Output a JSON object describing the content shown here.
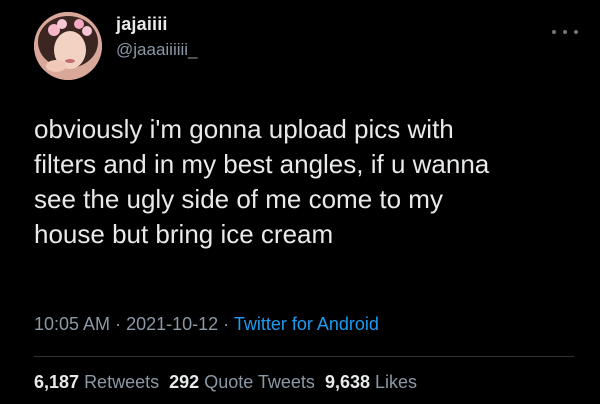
{
  "author": {
    "display_name": "jajaiiii",
    "handle": "@jaaaiiiiii_"
  },
  "tweet": {
    "text": "obviously i'm gonna upload pics with\nfilters and in my best angles, if u wanna\nsee the ugly side of me come to my\nhouse but bring ice cream"
  },
  "meta": {
    "time": "10:05 AM",
    "sep1": " · ",
    "date": "2021-10-12",
    "sep2": " · ",
    "source": "Twitter for Android"
  },
  "stats": {
    "retweets_count": "6,187",
    "retweets_label": "Retweets",
    "quotes_count": "292",
    "quotes_label": "Quote Tweets",
    "likes_count": "9,638",
    "likes_label": "Likes"
  },
  "icons": {
    "more": "more-horizontal-icon"
  }
}
